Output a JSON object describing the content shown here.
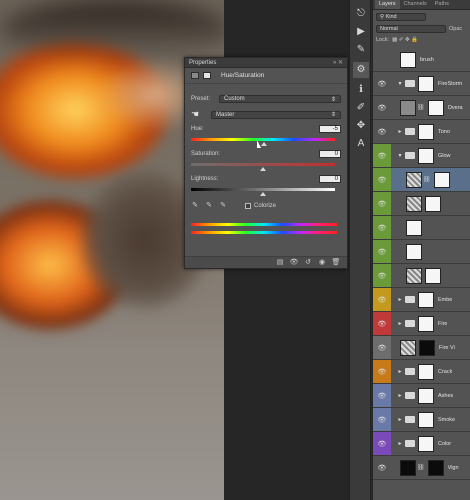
{
  "properties": {
    "title": "Properties",
    "adjustment_name": "Hue/Saturation",
    "preset_label": "Preset:",
    "preset_value": "Custom",
    "channel_value": "Master",
    "hue_label": "Hue:",
    "hue_value": "-5",
    "saturation_label": "Saturation:",
    "saturation_value": "0",
    "lightness_label": "Lightness:",
    "lightness_value": "0",
    "colorize_label": "Colorize"
  },
  "layers_panel": {
    "tabs": [
      "Layers",
      "Channels",
      "Paths"
    ],
    "filter_value": "Kind",
    "blend_mode": "Normal",
    "opacity_label": "Opac",
    "lock_label": "Lock:",
    "items": [
      {
        "name": "brush",
        "color": "#535353",
        "kind": "white"
      },
      {
        "name": "FireStorm",
        "color": "#535353",
        "kind": "group"
      },
      {
        "name": "Overa",
        "color": "#535353",
        "kind": "adjust"
      },
      {
        "name": "Tono",
        "color": "#535353",
        "kind": "group"
      },
      {
        "name": "Glow",
        "color": "#6b9a3b",
        "kind": "group"
      },
      {
        "name": "",
        "color": "#6b9a3b",
        "kind": "selected"
      },
      {
        "name": "",
        "color": "#6b9a3b",
        "kind": "fire"
      },
      {
        "name": "",
        "color": "#6b9a3b",
        "kind": "white"
      },
      {
        "name": "",
        "color": "#6b9a3b",
        "kind": "white"
      },
      {
        "name": "",
        "color": "#6b9a3b",
        "kind": "fire"
      },
      {
        "name": "Embe",
        "color": "#c49a1e",
        "kind": "group"
      },
      {
        "name": "Fire",
        "color": "#c13a3a",
        "kind": "group"
      },
      {
        "name": "Fire Vi",
        "color": "#6d6d6d",
        "kind": "fire-k"
      },
      {
        "name": "Crack",
        "color": "#c77a1a",
        "kind": "group"
      },
      {
        "name": "Ashes",
        "color": "#6a7aa8",
        "kind": "group"
      },
      {
        "name": "Smoke",
        "color": "#6a7aa8",
        "kind": "group"
      },
      {
        "name": "Color",
        "color": "#7a4bb8",
        "kind": "group"
      },
      {
        "name": "Vign",
        "color": "#535353",
        "kind": "vign"
      }
    ]
  }
}
